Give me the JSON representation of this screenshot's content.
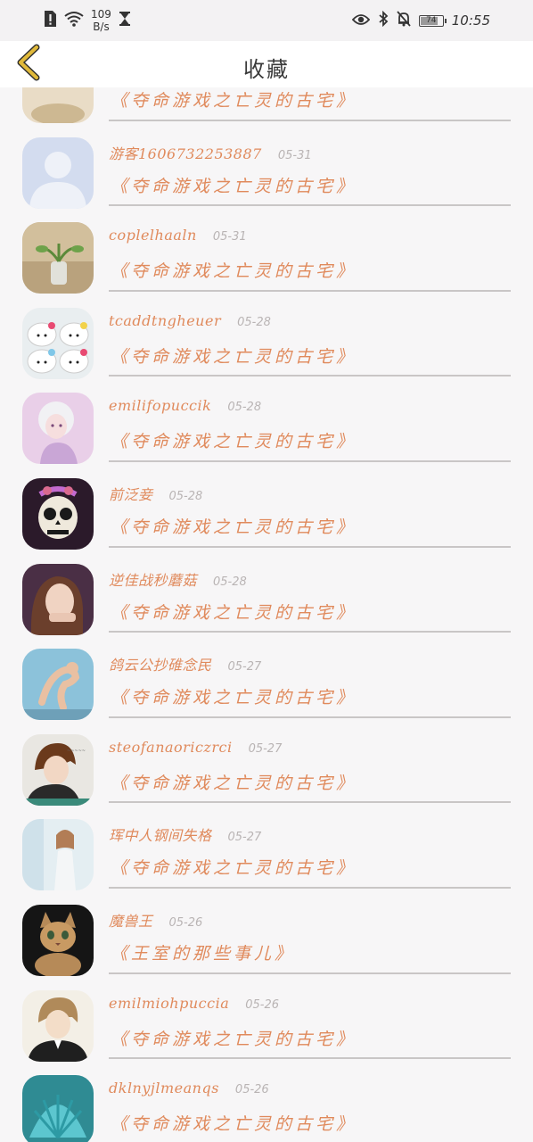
{
  "status_bar": {
    "net_speed_value": "109",
    "net_speed_unit": "B/s",
    "battery_level": "74",
    "time": "10:55"
  },
  "header": {
    "title": "收藏",
    "back_icon": "chevron-left-icon"
  },
  "items": [
    {
      "name": "",
      "date": "",
      "book": "《夺命游戏之亡灵的古宅》",
      "avatar": "partial-avatar"
    },
    {
      "name": "游客1606732253887",
      "date": "05-31",
      "book": "《夺命游戏之亡灵的古宅》",
      "avatar": "default-user-avatar"
    },
    {
      "name": "coplelhaaln",
      "date": "05-31",
      "book": "《夺命游戏之亡灵的古宅》",
      "avatar": "plant-in-vase-avatar"
    },
    {
      "name": "tcaddtngheuer",
      "date": "05-28",
      "book": "《夺命游戏之亡灵的古宅》",
      "avatar": "hello-kitty-avatar"
    },
    {
      "name": "emilifopuccik",
      "date": "05-28",
      "book": "《夺命游戏之亡灵的古宅》",
      "avatar": "anime-girl-avatar"
    },
    {
      "name": "前泛妾",
      "date": "05-28",
      "book": "《夺命游戏之亡灵的古宅》",
      "avatar": "sugar-skull-avatar"
    },
    {
      "name": "逆佳战秒蘑菇",
      "date": "05-28",
      "book": "《夺命游戏之亡灵的古宅》",
      "avatar": "girl-portrait-avatar"
    },
    {
      "name": "鸽云公抄碓念民",
      "date": "05-27",
      "book": "《夺命游戏之亡灵的古宅》",
      "avatar": "dancing-cat-avatar"
    },
    {
      "name": "steofanaoriczrci",
      "date": "05-27",
      "book": "《夺命游戏之亡灵的古宅》",
      "avatar": "boy-portrait-avatar"
    },
    {
      "name": "珲中人钢间失格",
      "date": "05-27",
      "book": "《夺命游戏之亡灵的古宅》",
      "avatar": "girl-window-avatar"
    },
    {
      "name": "魔兽王",
      "date": "05-26",
      "book": "《王室的那些事儿》",
      "avatar": "kitten-avatar"
    },
    {
      "name": "emilmiohpuccia",
      "date": "05-26",
      "book": "《夺命游戏之亡灵的古宅》",
      "avatar": "anime-boy-avatar"
    },
    {
      "name": "dklnyjlmeanqs",
      "date": "05-26",
      "book": "《夺命游戏之亡灵的古宅》",
      "avatar": "seashell-avatar"
    }
  ],
  "colors": {
    "accent": "#e08a5c",
    "date": "#b9b4b4",
    "back_icon": "#e0b93a",
    "divider": "#c9c6c6"
  }
}
